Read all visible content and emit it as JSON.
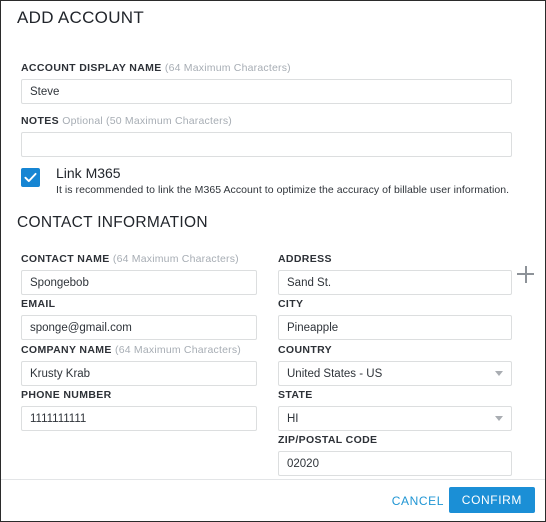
{
  "dialog": {
    "title": "ADD ACCOUNT"
  },
  "account": {
    "display_name": {
      "label": "ACCOUNT DISPLAY NAME",
      "hint": "(64 Maximum Characters)",
      "value": "Steve",
      "placeholder": ""
    },
    "notes": {
      "label": "NOTES",
      "hint": "Optional (50 Maximum Characters)",
      "value": "",
      "placeholder": ""
    },
    "link_m365": {
      "title": "Link M365",
      "description": "It is recommended to link the M365 Account to optimize the accuracy of billable user information.",
      "checked": "true",
      "icon": "checkmark-icon"
    }
  },
  "contact_section": {
    "heading": "CONTACT INFORMATION",
    "contact_name": {
      "label": "CONTACT NAME",
      "hint": "(64 Maximum Characters)",
      "value": "Spongebob",
      "placeholder": ""
    },
    "email": {
      "label": "EMAIL",
      "hint": "",
      "value": "sponge@gmail.com",
      "placeholder": ""
    },
    "company_name": {
      "label": "COMPANY NAME",
      "hint": "(64 Maximum Characters)",
      "value": "Krusty Krab",
      "placeholder": ""
    },
    "phone_number": {
      "label": "PHONE NUMBER",
      "hint": "",
      "value": "1111111111",
      "placeholder": ""
    },
    "address": {
      "label": "ADDRESS",
      "hint": "",
      "value": "Sand St.",
      "placeholder": "",
      "add_icon": "plus-icon"
    },
    "city": {
      "label": "CITY",
      "hint": "",
      "value": "Pineapple",
      "placeholder": ""
    },
    "country": {
      "label": "COUNTRY",
      "hint": "",
      "value": "United States - US",
      "icon": "chevron-down-icon"
    },
    "state": {
      "label": "STATE",
      "hint": "",
      "value": "HI",
      "icon": "chevron-down-icon"
    },
    "zip": {
      "label": "ZIP/POSTAL CODE",
      "hint": "",
      "value": "02020",
      "placeholder": ""
    }
  },
  "footer": {
    "cancel_label": "CANCEL",
    "confirm_label": "CONFIRM"
  },
  "colors": {
    "accent": "#1b8fd6",
    "link": "#2196d4",
    "text": "#21252b",
    "hint": "#a7adb4",
    "border": "#dcdedf"
  }
}
